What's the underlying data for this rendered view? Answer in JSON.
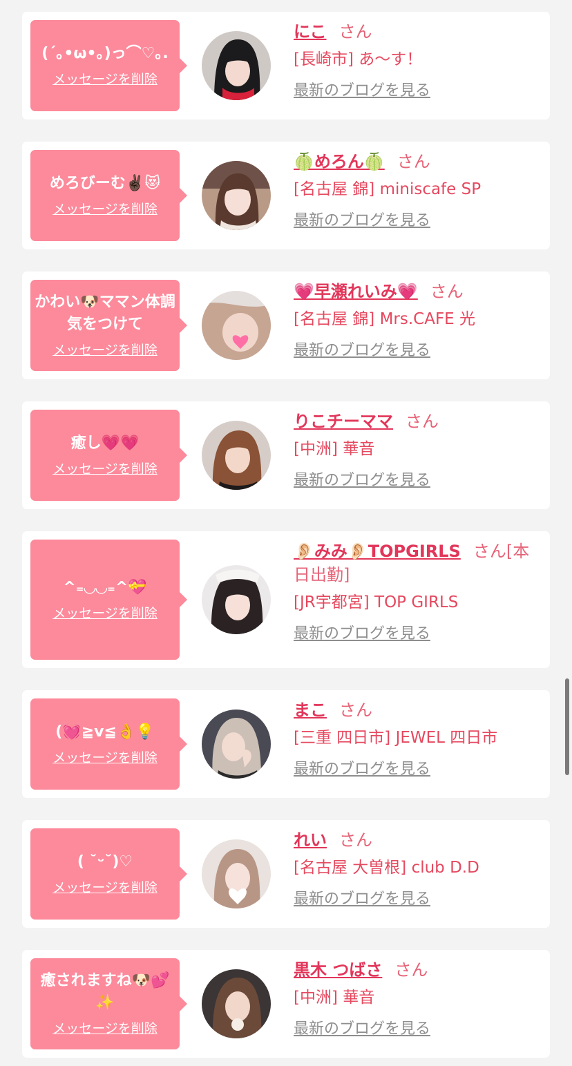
{
  "favorites": [
    {
      "message": "(´｡•ω•｡)っ⌒♡｡.",
      "delete_label": "メッセージを削除",
      "name": "にこ",
      "honorific": "さん",
      "shop": "[長崎市] あ～す！",
      "blog_label": "最新のブログを見る"
    },
    {
      "message": "めろびーむ✌🏿😻",
      "delete_label": "メッセージを削除",
      "name": "🍈めろん🍈",
      "honorific": "さん",
      "shop": "[名古屋 錦] miniscafe SP",
      "blog_label": "最新のブログを見る"
    },
    {
      "message": "かわい🐶ママン体調気をつけて",
      "delete_label": "メッセージを削除",
      "name": "💗早瀬れいみ💗",
      "honorific": "さん",
      "shop": "[名古屋 錦] Mrs.CAFE 光",
      "blog_label": "最新のブログを見る"
    },
    {
      "message": "癒し💗💗",
      "delete_label": "メッセージを削除",
      "name": "りこチーママ",
      "honorific": "さん",
      "shop": "[中洲] 華音",
      "blog_label": "最新のブログを見る"
    },
    {
      "message": "^₌◡◡₌^💝",
      "delete_label": "メッセージを削除",
      "name": "👂🏻みみ👂🏻TOPGIRLS",
      "honorific": "さん[本日出勤]",
      "shop": "[JR宇都宮] TOP GIRLS",
      "blog_label": "最新のブログを見る"
    },
    {
      "message": "(💓≧v≦👌💡",
      "delete_label": "メッセージを削除",
      "name": "まこ",
      "honorific": "さん",
      "shop": "[三重 四日市] JEWEL 四日市",
      "blog_label": "最新のブログを見る"
    },
    {
      "message": "( ˘ᵕ˘)♡",
      "delete_label": "メッセージを削除",
      "name": "れい",
      "honorific": "さん",
      "shop": "[名古屋 大曽根] club D.D",
      "blog_label": "最新のブログを見る"
    },
    {
      "message": "癒されますね🐶💕✨",
      "delete_label": "メッセージを削除",
      "name": "黒木 つばさ",
      "honorific": "さん",
      "shop": "[中洲] 華音",
      "blog_label": "最新のブログを見る"
    }
  ],
  "colors": {
    "bubble": "#fc8a9b",
    "name": "#e2365a",
    "shop_text": "#e5495f",
    "blog_link": "#8e8e8e",
    "background": "#f3f3f3"
  }
}
